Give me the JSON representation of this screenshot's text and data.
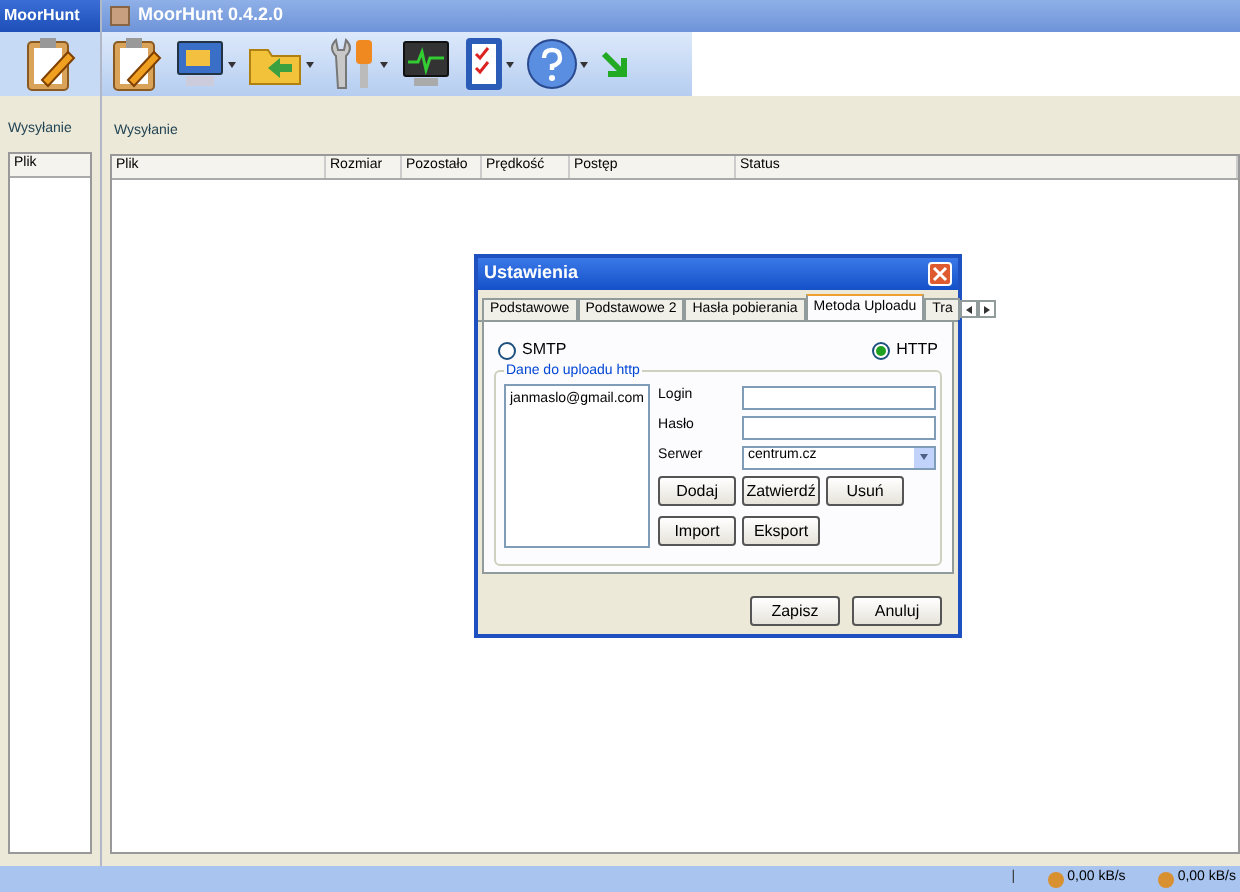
{
  "back_window": {
    "title": "MoorHunt",
    "panel_title": "Wysyłanie",
    "column": "Plik"
  },
  "window": {
    "title": "MoorHunt 0.4.2.0"
  },
  "toolbar": [
    {
      "kind": "clipboard",
      "dropdown": false
    },
    {
      "kind": "monitor",
      "dropdown": true
    },
    {
      "kind": "folder",
      "dropdown": true
    },
    {
      "kind": "tools",
      "dropdown": true
    },
    {
      "kind": "chart",
      "dropdown": false
    },
    {
      "kind": "checklist",
      "dropdown": true
    },
    {
      "kind": "help",
      "dropdown": true
    },
    {
      "kind": "arrow",
      "dropdown": false
    }
  ],
  "panel_title": "Wysyłanie",
  "table": {
    "columns": [
      "Plik",
      "Rozmiar",
      "Pozostało",
      "Prędkość",
      "Postęp",
      "Status"
    ]
  },
  "dialog": {
    "title": "Ustawienia",
    "tabs": [
      {
        "label": "Podstawowe",
        "selected": false
      },
      {
        "label": "Podstawowe 2",
        "selected": false
      },
      {
        "label": "Hasła pobierania",
        "selected": false
      },
      {
        "label": "Metoda Uploadu",
        "selected": true
      },
      {
        "label": "Tra",
        "selected": false
      }
    ],
    "methods": [
      {
        "label": "SMTP",
        "selected": false
      },
      {
        "label": "HTTP",
        "selected": true
      }
    ],
    "group_title": "Dane do uploadu http",
    "accounts": [
      "janmaslo@gmail.com"
    ],
    "fields": [
      {
        "kind": "text",
        "label": "Login"
      },
      {
        "kind": "text",
        "label": "Hasło"
      },
      {
        "kind": "select",
        "label": "Serwer",
        "value": "centrum.cz"
      }
    ],
    "buttons_row_1": [
      "Dodaj",
      "Zatwierdź",
      "Usuń"
    ],
    "buttons_row_2": [
      "Import",
      "Eksport"
    ],
    "footer_buttons": [
      "Zapisz",
      "Anuluj"
    ]
  },
  "status_bar": {
    "separator": "|",
    "upload": "0,00 kB/s",
    "download": "0,00 kB/s"
  }
}
